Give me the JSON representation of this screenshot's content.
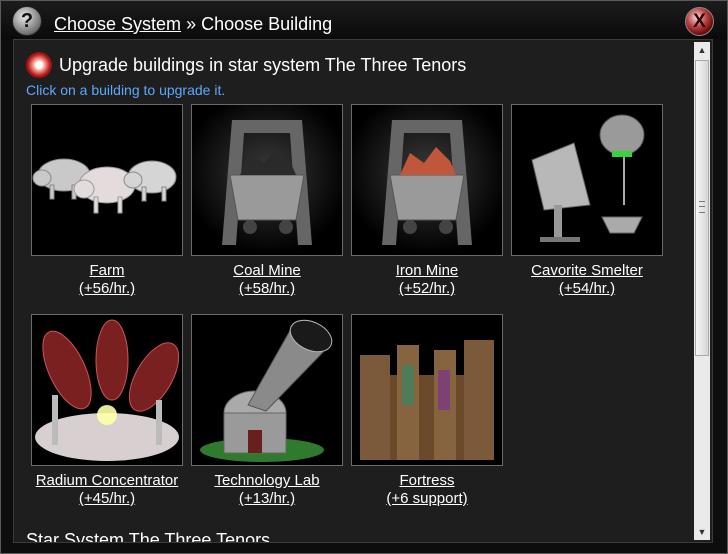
{
  "titlebar": {
    "help_label": "?",
    "crumb_link": "Choose System",
    "crumb_separator": " » ",
    "crumb_current": "Choose Building",
    "close_label": "X"
  },
  "content": {
    "heading": "Upgrade buildings in star system The Three Tenors",
    "hint": "Click on a building to upgrade it.",
    "section_heading": "Star System The Three Tenors"
  },
  "buildings": [
    {
      "name": "Farm",
      "rate": "(+56/hr.)",
      "icon": "farm-pigs-icon"
    },
    {
      "name": "Coal Mine",
      "rate": "(+58/hr.)",
      "icon": "coal-mine-cart-icon"
    },
    {
      "name": "Iron Mine",
      "rate": "(+52/hr.)",
      "icon": "iron-mine-cart-icon"
    },
    {
      "name": "Cavorite Smelter",
      "rate": "(+54/hr.)",
      "icon": "smelter-icon"
    },
    {
      "name": "Radium Concentrator",
      "rate": "(+45/hr.)",
      "icon": "radium-concentrator-icon"
    },
    {
      "name": "Technology Lab",
      "rate": "(+13/hr.)",
      "icon": "telescope-lab-icon"
    },
    {
      "name": "Fortress",
      "rate": "(+6 support)",
      "icon": "fortress-icon"
    }
  ],
  "scrollbar": {
    "up_arrow": "▲",
    "down_arrow": "▼"
  },
  "colors": {
    "hint": "#5aa9ff",
    "panel": "#1e1e1e",
    "accent_red": "#b01818"
  }
}
